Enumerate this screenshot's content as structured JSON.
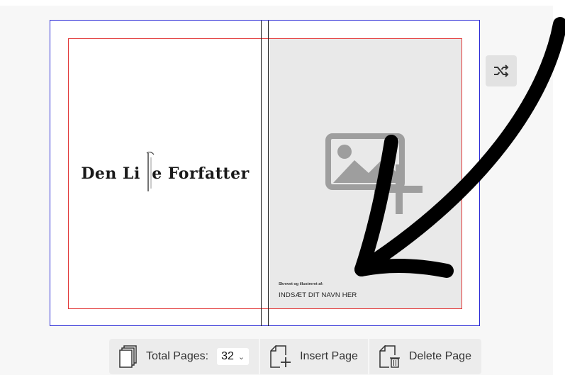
{
  "spread": {
    "logo_text": "Den Li  e Forfatter",
    "credit_small": "Skrevet og illustreret af:",
    "credit_name": "INDSÆT DIT NAVN HER"
  },
  "toolbar": {
    "total_pages_label": "Total Pages:",
    "total_pages_value": "32",
    "insert_page_label": "Insert Page",
    "delete_page_label": "Delete Page"
  },
  "icons": {
    "shuffle": "shuffle-icon",
    "pages": "pages-stack-icon",
    "insert": "insert-page-icon",
    "delete": "delete-page-icon",
    "image_placeholder": "add-image-icon"
  },
  "colors": {
    "bleed_border": "#2b2bd6",
    "safe_border": "#e23a3a",
    "arrow": "#000000"
  }
}
